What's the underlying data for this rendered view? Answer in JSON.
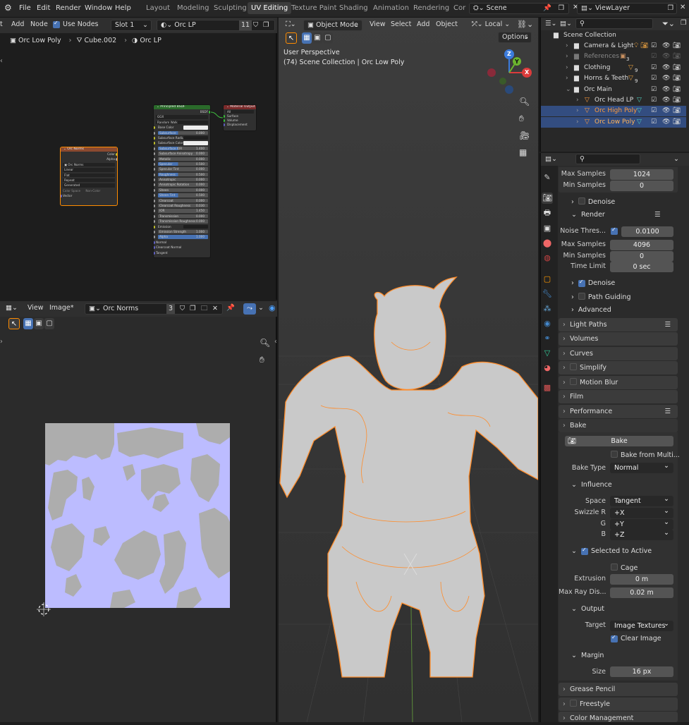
{
  "topbar": {
    "menus": [
      "File",
      "Edit",
      "Render",
      "Window",
      "Help"
    ],
    "workspaces": [
      "Layout",
      "Modeling",
      "Sculpting",
      "UV Editing",
      "Texture Paint",
      "Shading",
      "Animation",
      "Rendering",
      "Cor"
    ],
    "active_workspace": "UV Editing",
    "scene": "Scene",
    "view_layer": "ViewLayer"
  },
  "node_editor": {
    "menus": [
      "Add",
      "Node"
    ],
    "use_nodes": "Use Nodes",
    "slot": "Slot 1",
    "material": "Orc LP",
    "material_users": "11",
    "breadcrumb": [
      "Orc Low Poly",
      "Cube.002",
      "Orc LP"
    ],
    "image_node": {
      "title": "Orc Norms",
      "outputs": [
        "Color",
        "Alpha"
      ],
      "image": "Orc Norms",
      "options": [
        "Linear",
        "Flat",
        "Repeat",
        "Generated"
      ],
      "color_space_label": "Color Space",
      "color_space": "Non-Color",
      "vector": "Vector"
    },
    "bsdf_node": {
      "title": "Principled BSDF",
      "output": "BSDF",
      "distribution": "GGX",
      "subsurface_method": "Random Walk",
      "rows": [
        {
          "label": "Base Color",
          "value": "",
          "kind": "white"
        },
        {
          "label": "Subsurface",
          "value": "0.000",
          "kind": "blue"
        },
        {
          "label": "Subsurface Radius",
          "value": "",
          "kind": "dark"
        },
        {
          "label": "Subsurface Color",
          "value": "",
          "kind": "white"
        },
        {
          "label": "Subsurface IOR",
          "value": "1.400",
          "kind": "blue"
        },
        {
          "label": "Subsurface Anisotropy",
          "value": "0.000",
          "kind": "plain"
        },
        {
          "label": "Metallic",
          "value": "0.000",
          "kind": "plain"
        },
        {
          "label": "Specular",
          "value": "0.500",
          "kind": "blue"
        },
        {
          "label": "Specular Tint",
          "value": "0.000",
          "kind": "plain"
        },
        {
          "label": "Roughness",
          "value": "0.500",
          "kind": "blue"
        },
        {
          "label": "Anisotropic",
          "value": "0.000",
          "kind": "plain"
        },
        {
          "label": "Anisotropic Rotation",
          "value": "0.000",
          "kind": "plain"
        },
        {
          "label": "Sheen",
          "value": "0.000",
          "kind": "plain"
        },
        {
          "label": "Sheen Tint",
          "value": "0.500",
          "kind": "blue"
        },
        {
          "label": "Clearcoat",
          "value": "0.000",
          "kind": "plain"
        },
        {
          "label": "Clearcoat Roughness",
          "value": "0.030",
          "kind": "plain"
        },
        {
          "label": "IOR",
          "value": "1.450",
          "kind": "plain"
        },
        {
          "label": "Transmission",
          "value": "0.000",
          "kind": "plain"
        },
        {
          "label": "Transmission Roughness",
          "value": "0.000",
          "kind": "plain"
        },
        {
          "label": "Emission",
          "value": "",
          "kind": "dark"
        },
        {
          "label": "Emission Strength",
          "value": "1.000",
          "kind": "plain"
        },
        {
          "label": "Alpha",
          "value": "1.000",
          "kind": "full"
        },
        {
          "label": "Normal",
          "value": "",
          "kind": "none"
        },
        {
          "label": "Clearcoat Normal",
          "value": "",
          "kind": "none"
        },
        {
          "label": "Tangent",
          "value": "",
          "kind": "none"
        }
      ]
    },
    "output_node": {
      "title": "Material Output",
      "target": "All",
      "inputs": [
        "Surface",
        "Volume",
        "Displacement"
      ]
    }
  },
  "image_editor": {
    "menus": [
      "View",
      "Image*"
    ],
    "image": "Orc Norms",
    "users": "3"
  },
  "viewport": {
    "mode": "Object Mode",
    "menus": [
      "View",
      "Select",
      "Add",
      "Object"
    ],
    "transform": "Local",
    "options": "Options",
    "perspective": "User Perspective",
    "collection_info": "(74) Scene Collection | Orc Low Poly",
    "gizmo": {
      "z": "Z",
      "y": "Y",
      "x": "X"
    }
  },
  "outliner": {
    "rows": [
      {
        "label": "Scene Collection",
        "indent": 0,
        "kind": "collection"
      },
      {
        "label": "Camera & Light",
        "indent": 1,
        "kind": "item"
      },
      {
        "label": "References",
        "indent": 1,
        "kind": "dim"
      },
      {
        "label": "Clothing",
        "indent": 1,
        "kind": "item",
        "count": "9"
      },
      {
        "label": "Horns & Teeth",
        "indent": 1,
        "kind": "item",
        "count": "9"
      },
      {
        "label": "Orc Main",
        "indent": 1,
        "kind": "item"
      },
      {
        "label": "Orc Head LP",
        "indent": 2,
        "kind": "mesh"
      },
      {
        "label": "Orc High Poly",
        "indent": 2,
        "kind": "mesh-sel"
      },
      {
        "label": "Orc Low Poly",
        "indent": 2,
        "kind": "mesh-active"
      }
    ],
    "refs_count": "3"
  },
  "properties": {
    "samples": [
      {
        "label": "Max Samples",
        "value": "1024"
      },
      {
        "label": "Min Samples",
        "value": "0"
      }
    ],
    "denoise_viewport": "Denoise",
    "render_label": "Render",
    "noise_threshold_label": "Noise Thres...",
    "noise_threshold": "0.0100",
    "render_samples": [
      {
        "label": "Max Samples",
        "value": "4096"
      },
      {
        "label": "Min Samples",
        "value": "0"
      },
      {
        "label": "Time Limit",
        "value": "0 sec"
      }
    ],
    "denoise_render": "Denoise",
    "path_guiding": "Path Guiding",
    "advanced": "Advanced",
    "panels_top": [
      "Light Paths",
      "Volumes",
      "Curves",
      "Simplify",
      "Motion Blur",
      "Film",
      "Performance"
    ],
    "bake_panel": "Bake",
    "bake_button": "Bake",
    "bake_from_multires": "Bake from Multi...",
    "bake_type_label": "Bake Type",
    "bake_type": "Normal",
    "influence": "Influence",
    "space_label": "Space",
    "space": "Tangent",
    "swizzle": [
      {
        "label": "Swizzle R",
        "value": "+X"
      },
      {
        "label": "G",
        "value": "+Y"
      },
      {
        "label": "B",
        "value": "+Z"
      }
    ],
    "selected_to_active": "Selected to Active",
    "cage": "Cage",
    "extrusion_label": "Extrusion",
    "extrusion": "0 m",
    "max_ray_label": "Max Ray Dis...",
    "max_ray": "0.02 m",
    "output": "Output",
    "target_label": "Target",
    "target": "Image Textures",
    "clear_image": "Clear Image",
    "margin": "Margin",
    "size_label": "Size",
    "size": "16 px",
    "panels_bottom": [
      "Grease Pencil",
      "Freestyle",
      "Color Management"
    ]
  },
  "colors": {
    "accent": "#4772b3",
    "selection": "#ff8c00",
    "uv_bg": "#bcbcff"
  }
}
